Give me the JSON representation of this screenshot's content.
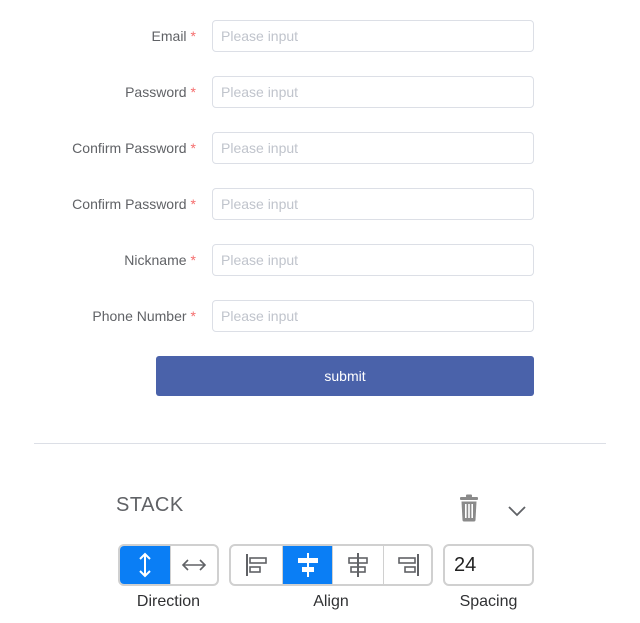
{
  "form": {
    "placeholder": "Please input",
    "required_mark": "*",
    "fields": [
      {
        "label": "Email"
      },
      {
        "label": "Password"
      },
      {
        "label": "Confirm Password"
      },
      {
        "label": "Confirm Password"
      },
      {
        "label": "Nickname"
      },
      {
        "label": "Phone Number"
      }
    ],
    "submit_label": "submit"
  },
  "stack": {
    "title": "STACK",
    "direction": {
      "caption": "Direction",
      "options": [
        "vertical-arrows-icon",
        "horizontal-arrows-icon"
      ],
      "selected": "vertical"
    },
    "align": {
      "caption": "Align",
      "options": [
        "align-left-icon",
        "align-center-icon",
        "align-center-alt-icon",
        "align-right-icon"
      ],
      "selected": "center"
    },
    "spacing": {
      "caption": "Spacing",
      "value": "24"
    }
  },
  "colors": {
    "primary": "#4a62aa",
    "active": "#0a7ef5",
    "required": "#f56c6c"
  }
}
